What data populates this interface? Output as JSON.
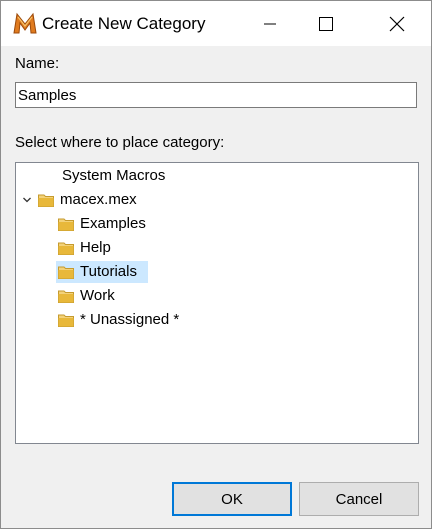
{
  "window": {
    "title": "Create New Category"
  },
  "form": {
    "name_label": "Name:",
    "name_value": "Samples",
    "tree_label": "Select where to place category:"
  },
  "tree": {
    "root": "System Macros",
    "parent": "macex.mex",
    "children": [
      "Examples",
      "Help",
      "Tutorials",
      "Work",
      "* Unassigned *"
    ],
    "selected": "Tutorials"
  },
  "buttons": {
    "ok": "OK",
    "cancel": "Cancel"
  },
  "colors": {
    "accent": "#0078d7",
    "selection": "#cce8ff",
    "folder": "#e8b83a"
  },
  "icons": {
    "app": "macro-express-m-icon",
    "folder": "folder-icon",
    "expand": "chevron-down-icon"
  }
}
